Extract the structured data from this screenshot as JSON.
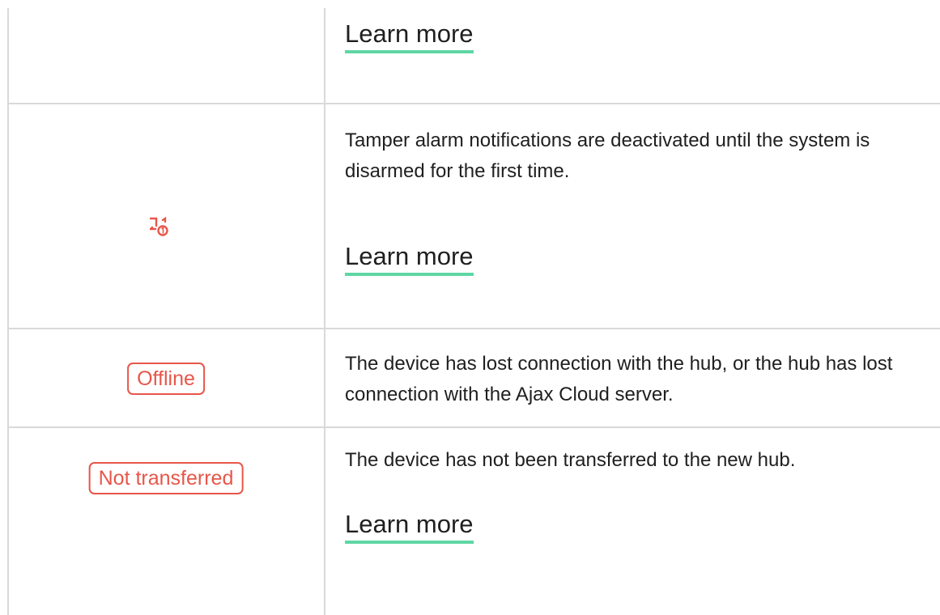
{
  "rows": [
    {
      "link_label": "Learn more"
    },
    {
      "icon": "tamper-delay-icon",
      "icon_color": "#e8564a",
      "description": "Tamper alarm notifications are deactivated until the system is disarmed for the first time.",
      "link_label": "Learn more"
    },
    {
      "badge": "Offline",
      "badge_color": "#e8564a",
      "description": "The device has lost connection with the hub, or the hub has lost connection with the Ajax Cloud server."
    },
    {
      "badge": "Not transferred",
      "badge_color": "#e8564a",
      "description": "The device has not been transferred to the new hub.",
      "link_label": "Learn more"
    }
  ],
  "link_underline_color": "#5fd6a4",
  "border_color": "#d9d9d9"
}
